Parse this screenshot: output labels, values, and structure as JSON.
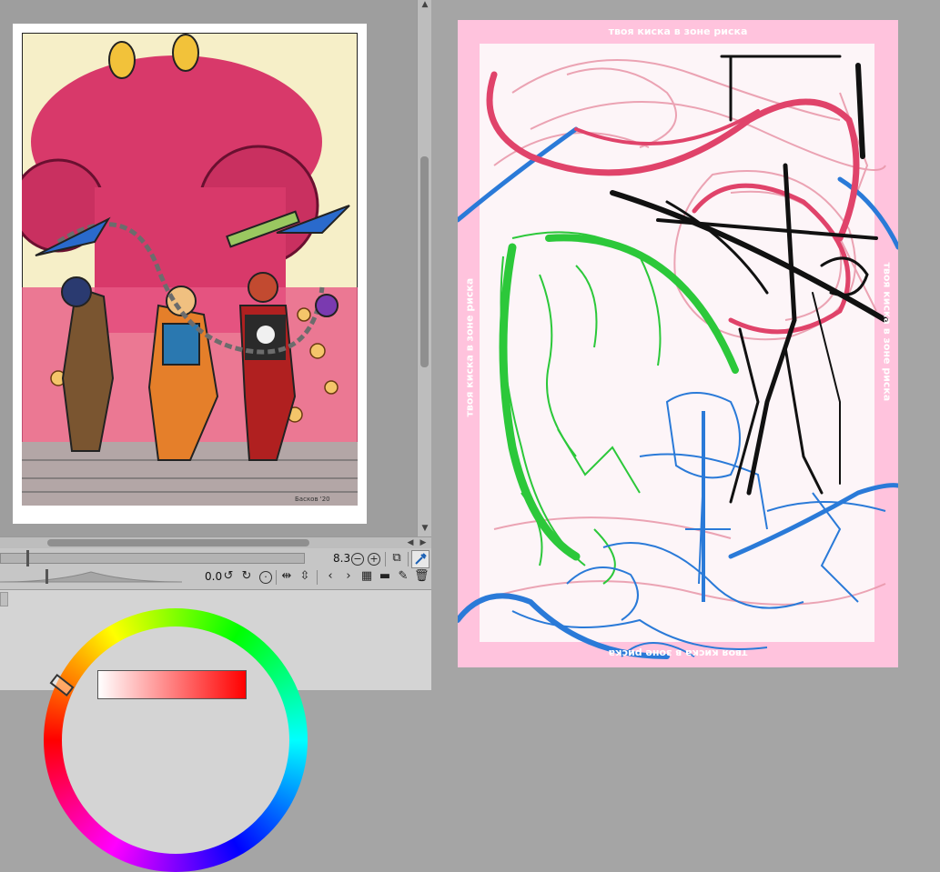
{
  "navigator": {
    "zoom_value": "8.3",
    "rotation_value": "0.0",
    "artwork_description_icon": "comic-cover-thumbnail",
    "artwork_signature": "Басков '20"
  },
  "canvas": {
    "frame_text": "твоя киска в зоне риска",
    "frame_color": "#ffc3dd",
    "stroke_colors": {
      "pink": "#e0436a",
      "blue": "#2a7ad8",
      "green": "#2cc83a",
      "black": "#111111"
    }
  },
  "color_panel": {
    "selected_color": "#ff0000"
  },
  "icons": {
    "zoom_out": "zoom-out-icon",
    "zoom_in": "zoom-in-icon",
    "fit": "fit-icon",
    "eyedropper": "eyedropper-icon",
    "rotate_left": "rotate-left-icon",
    "rotate_right": "rotate-right-icon",
    "reset_rotate": "reset-rotate-icon",
    "flip_h": "flip-horizontal-icon",
    "flip_v": "flip-vertical-icon",
    "prev": "previous-icon",
    "next": "next-icon",
    "grid": "grid-icon",
    "folder": "folder-icon",
    "edit": "edit-icon",
    "trash": "trash-icon"
  }
}
